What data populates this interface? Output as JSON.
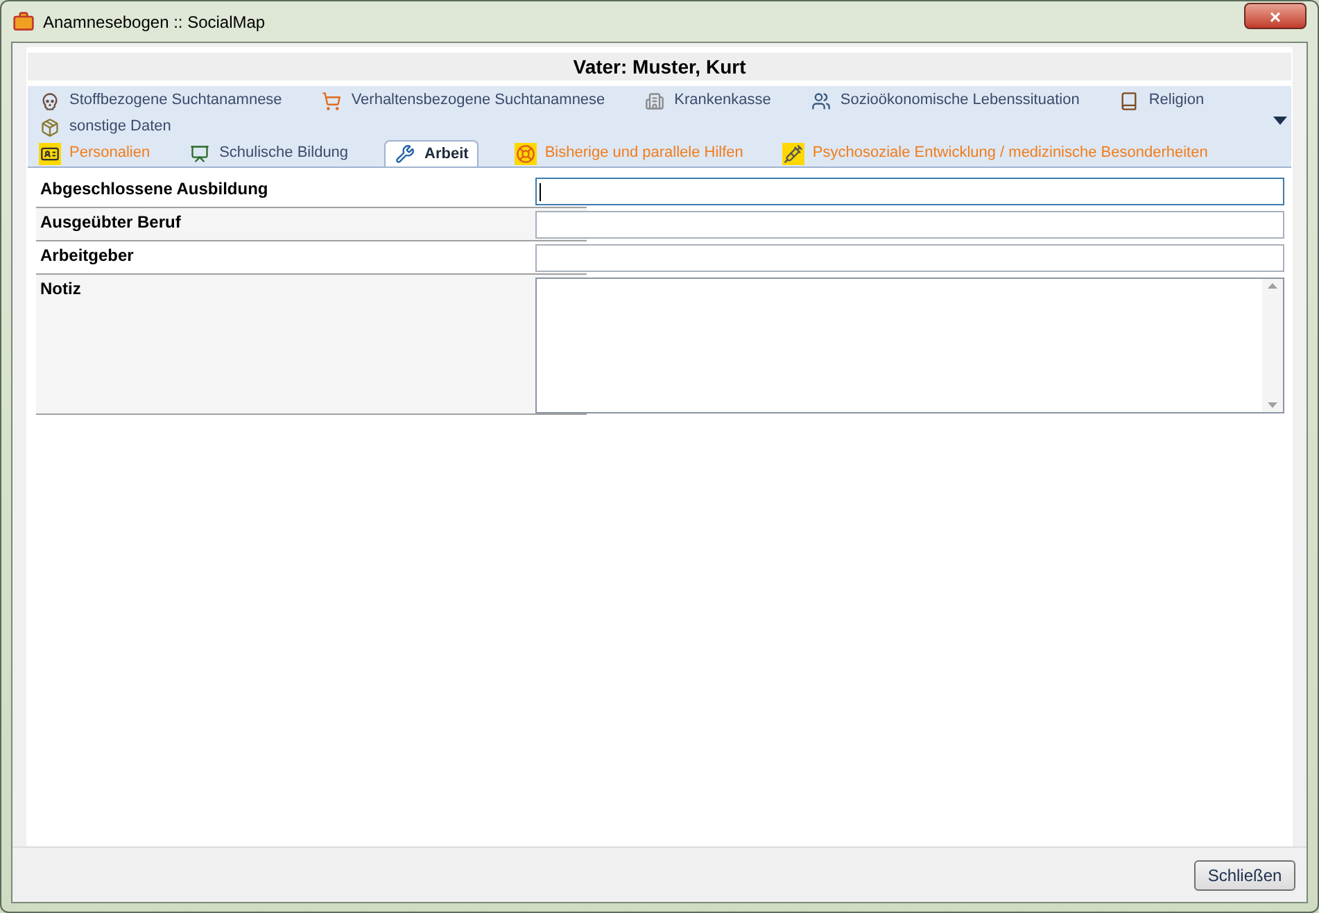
{
  "window": {
    "title": "Anamnesebogen :: SocialMap",
    "close": "×"
  },
  "header": "Vater: Muster, Kurt",
  "tab_rows": [
    [
      {
        "label": "Stoffbezogene Suchtanamnese",
        "selected": false,
        "highlighted": false
      },
      {
        "label": "Verhaltensbezogene Suchtanamnese",
        "selected": false,
        "highlighted": false
      },
      {
        "label": "Krankenkasse",
        "selected": false,
        "highlighted": false
      },
      {
        "label": "Sozioökonomische Lebenssituation",
        "selected": false,
        "highlighted": false
      },
      {
        "label": "Religion",
        "selected": false,
        "highlighted": false
      },
      {
        "label": "sonstige Daten",
        "selected": false,
        "highlighted": false
      }
    ],
    [
      {
        "label": "Personalien",
        "selected": false,
        "highlighted": true
      },
      {
        "label": "Schulische Bildung",
        "selected": false,
        "highlighted": false
      },
      {
        "label": "Arbeit",
        "selected": true,
        "highlighted": false
      },
      {
        "label": "Bisherige und parallele Hilfen",
        "selected": false,
        "highlighted": true
      },
      {
        "label": "Psychosoziale Entwicklung / medizinische Besonderheiten",
        "selected": false,
        "highlighted": true
      }
    ]
  ],
  "fields": [
    {
      "label": "Abgeschlossene Ausbildung",
      "kind": "line",
      "focused": true
    },
    {
      "label": "Ausgeübter Beruf",
      "kind": "line",
      "focused": false
    },
    {
      "label": "Arbeitgeber",
      "kind": "line",
      "focused": false
    },
    {
      "label": "Notiz",
      "kind": "multiline",
      "focused": false
    }
  ],
  "buttons": [
    "Schließen"
  ]
}
